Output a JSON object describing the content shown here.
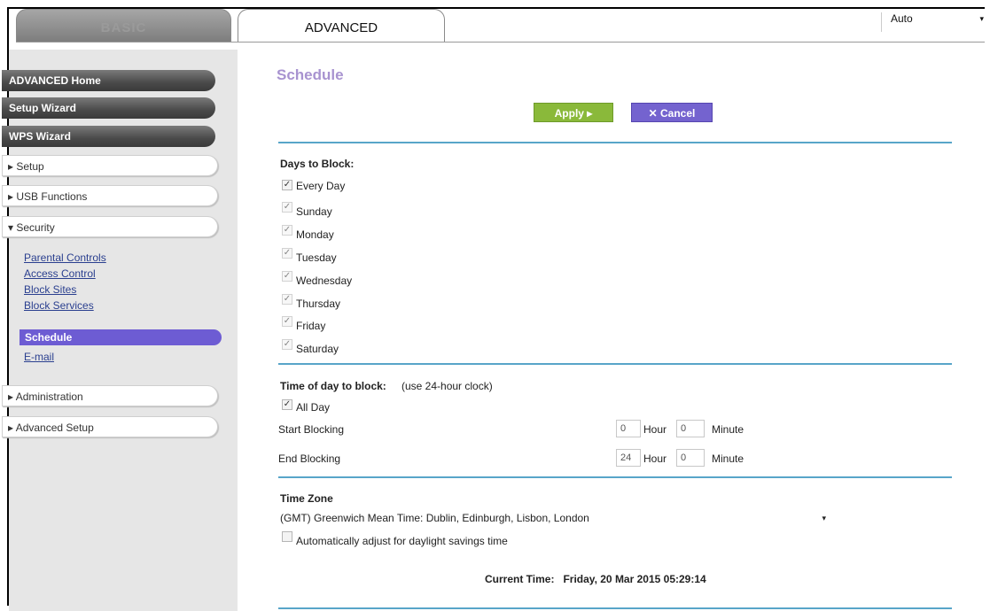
{
  "tabs": {
    "basic": "BASIC",
    "advanced": "ADVANCED"
  },
  "language": {
    "value": "Auto",
    "arrow": "▾"
  },
  "sidebar": {
    "dark_buttons": [
      "ADVANCED Home",
      "Setup Wizard",
      "WPS Wizard"
    ],
    "sections": [
      "▸ Setup",
      "▸ USB Functions",
      "▾ Security"
    ],
    "security_links": [
      "Parental Controls",
      "Access Control",
      "Block Sites",
      "Block Services",
      "Schedule",
      "E-mail"
    ],
    "lower_sections": [
      "▸ Administration",
      "▸ Advanced Setup"
    ]
  },
  "page": {
    "title": "Schedule",
    "apply_label": "Apply ▸",
    "cancel_label": "✕ Cancel"
  },
  "days": {
    "heading": "Days to Block:",
    "items": [
      "Every Day",
      "Sunday",
      "Monday",
      "Tuesday",
      "Wednesday",
      "Thursday",
      "Friday",
      "Saturday"
    ],
    "checkmark": "✓"
  },
  "time": {
    "heading": "Time of day to block:",
    "heading_note": "(use 24-hour clock)",
    "all_day_label": "All Day",
    "start_label": "Start Blocking",
    "end_label": "End Blocking",
    "start_hour": "0",
    "start_minute": "0",
    "end_hour": "24",
    "end_minute": "0",
    "hour_label": "Hour",
    "minute_label": "Minute"
  },
  "timezone": {
    "heading": "Time Zone",
    "selected": "(GMT) Greenwich Mean Time: Dublin, Edinburgh, Lisbon, London",
    "dst_label": "Automatically adjust for daylight savings time",
    "current_time_label": "Current Time:",
    "current_time_value": "Friday, 20 Mar 2015 05:29:14"
  }
}
